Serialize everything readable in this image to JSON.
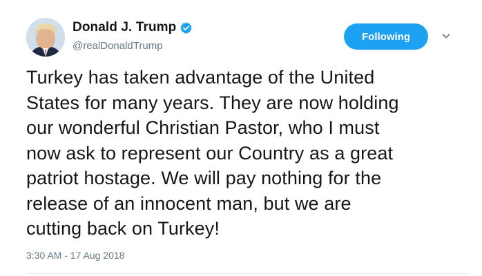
{
  "tweet": {
    "author": {
      "display_name": "Donald J. Trump",
      "handle": "@realDonaldTrump",
      "verified": true
    },
    "follow_button_label": "Following",
    "text": "Turkey has taken advantage of the United\nStates for many years. They are now holding\nour wonderful Christian Pastor, who I must\nnow ask to represent our Country as a great\npatriot hostage. We will pay nothing for the\nrelease of an innocent man, but we are\ncutting back on Turkey!",
    "timestamp": "3:30 AM - 17 Aug 2018"
  },
  "colors": {
    "accent": "#1da1f2",
    "secondary_text": "#657786",
    "primary_text": "#14171a"
  },
  "icons": {
    "verified": "verified-badge-icon",
    "caret": "chevron-down-icon"
  }
}
